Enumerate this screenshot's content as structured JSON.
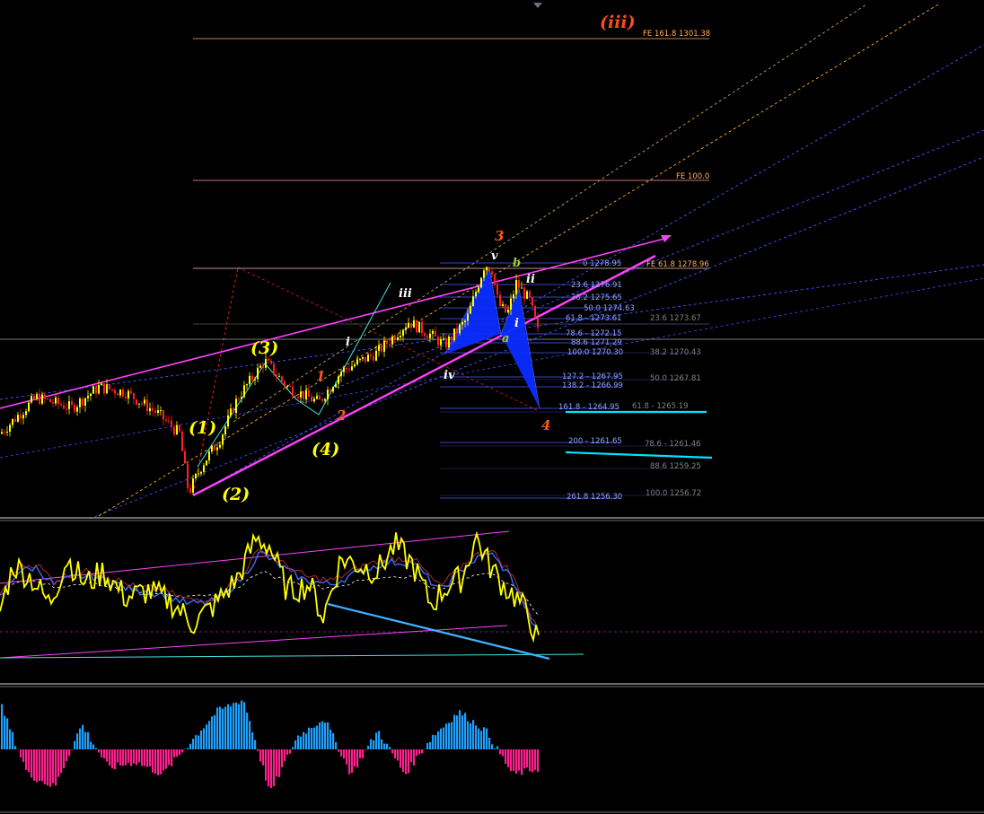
{
  "colors": {
    "background": "#000000",
    "bull_candle": "#ffff00",
    "bear_candle": "#ff2020",
    "fib_level": "#4a5cff",
    "fe_level": "#ffb060",
    "channel": "#ff40ff",
    "trend_dotted": "#4455ff",
    "dotted_orange": "#ffb020",
    "target_cyan": "#00e5ff",
    "harmonic_fill": "#0a2cff",
    "osc_main": "#ffff00",
    "osc_signal": "#3c6cff",
    "hist_pos": "#1ea0ff",
    "hist_neg": "#ff2090"
  },
  "labels": {
    "top_wave": "(iii)",
    "w1": "(1)",
    "w2": "(2)",
    "w3": "(3)",
    "w4": "(4)",
    "r1": "1",
    "r2": "2",
    "r3": "3",
    "r4": "4",
    "mi": "i",
    "miii": "iii",
    "miv": "iv",
    "mv": "v",
    "ma": "a",
    "mb": "b",
    "mi2": "i",
    "mii": "ii"
  },
  "fe_levels": [
    {
      "text": "FE 161.8  1301.38"
    },
    {
      "text": "FE 100.0"
    },
    {
      "text": "FE 61.8  1278.96"
    }
  ],
  "fib_levels": [
    {
      "text": "0  1278.95"
    },
    {
      "text": "23.6  1276.91"
    },
    {
      "text": "38.2  1275.65"
    },
    {
      "text": "50.0  1274.63"
    },
    {
      "text": "61.8 - 1273.61"
    },
    {
      "text": "78.6 - 1272.15"
    },
    {
      "text": "88.6  1271.29"
    },
    {
      "text": "100.0  1270.30"
    },
    {
      "text": "127.2 - 1267.95"
    },
    {
      "text": "138.2 - 1266.99"
    },
    {
      "text": "161.8 - 1264.95"
    },
    {
      "text": "200 - 1261.65"
    },
    {
      "text": "261.8  1256.30"
    }
  ],
  "retrace_levels": [
    {
      "text": "23.6  1273.67"
    },
    {
      "text": "38.2  1270.43"
    },
    {
      "text": "50.0  1267.81"
    },
    {
      "text": "61.8 - 1265.19"
    },
    {
      "text": "78.6 - 1261.46"
    },
    {
      "text": "88.6  1259.25"
    },
    {
      "text": "100.0  1256.72"
    }
  ],
  "chart_data": {
    "type": "line",
    "panels": [
      "price",
      "oscillator",
      "histogram"
    ],
    "price": {
      "series": [
        {
          "x": [
            0,
            40,
            80,
            110,
            140,
            175,
            200,
            210,
            225,
            245,
            265,
            295,
            320,
            355,
            380,
            420,
            455,
            480,
            495,
            520,
            540,
            548,
            555,
            565,
            575,
            590,
            600
          ],
          "y": [
            1262.5,
            1266.0,
            1265.0,
            1267.0,
            1266.5,
            1264.5,
            1262.5,
            1256.8,
            1259.5,
            1262.0,
            1266.0,
            1269.5,
            1267.0,
            1265.5,
            1268.5,
            1270.3,
            1273.3,
            1272.0,
            1271.0,
            1273.5,
            1278.9,
            1278.3,
            1275.0,
            1274.0,
            1277.0,
            1275.3,
            1272.0
          ]
        }
      ]
    },
    "oscillator": {
      "series": [
        {
          "x": [
            0,
            15,
            35,
            55,
            75,
            95,
            115,
            140,
            165,
            190,
            215,
            240,
            265,
            285,
            300,
            320,
            345,
            360,
            380,
            400,
            420,
            440,
            460,
            480,
            500,
            515,
            530,
            545,
            560,
            575,
            590,
            600
          ],
          "y": [
            35,
            70,
            60,
            40,
            75,
            55,
            65,
            45,
            50,
            42,
            25,
            40,
            60,
            90,
            85,
            50,
            55,
            30,
            75,
            70,
            65,
            85,
            70,
            40,
            55,
            60,
            92,
            70,
            55,
            45,
            30,
            8
          ]
        },
        {
          "x": [
            0,
            20,
            40,
            60,
            80,
            100,
            120,
            150,
            180,
            210,
            240,
            270,
            290,
            310,
            340,
            370,
            400,
            430,
            460,
            490,
            520,
            545,
            570,
            600
          ],
          "y": [
            45,
            65,
            68,
            55,
            60,
            62,
            58,
            50,
            48,
            40,
            42,
            60,
            80,
            70,
            58,
            55,
            65,
            72,
            72,
            50,
            70,
            80,
            60,
            15
          ]
        }
      ]
    },
    "histogram": {
      "series": [
        {
          "x": [
            0,
            30,
            60,
            90,
            120,
            150,
            180,
            210,
            240,
            270,
            300,
            330,
            360,
            390,
            420,
            450,
            480,
            510,
            540,
            570,
            600
          ],
          "y": [
            0.7,
            -0.4,
            -0.6,
            0.4,
            -0.3,
            -0.2,
            -0.4,
            0.1,
            0.6,
            0.8,
            -0.7,
            0.2,
            0.5,
            -0.4,
            0.3,
            -0.4,
            0.2,
            0.6,
            0.3,
            -0.4,
            -0.3
          ]
        }
      ]
    }
  }
}
